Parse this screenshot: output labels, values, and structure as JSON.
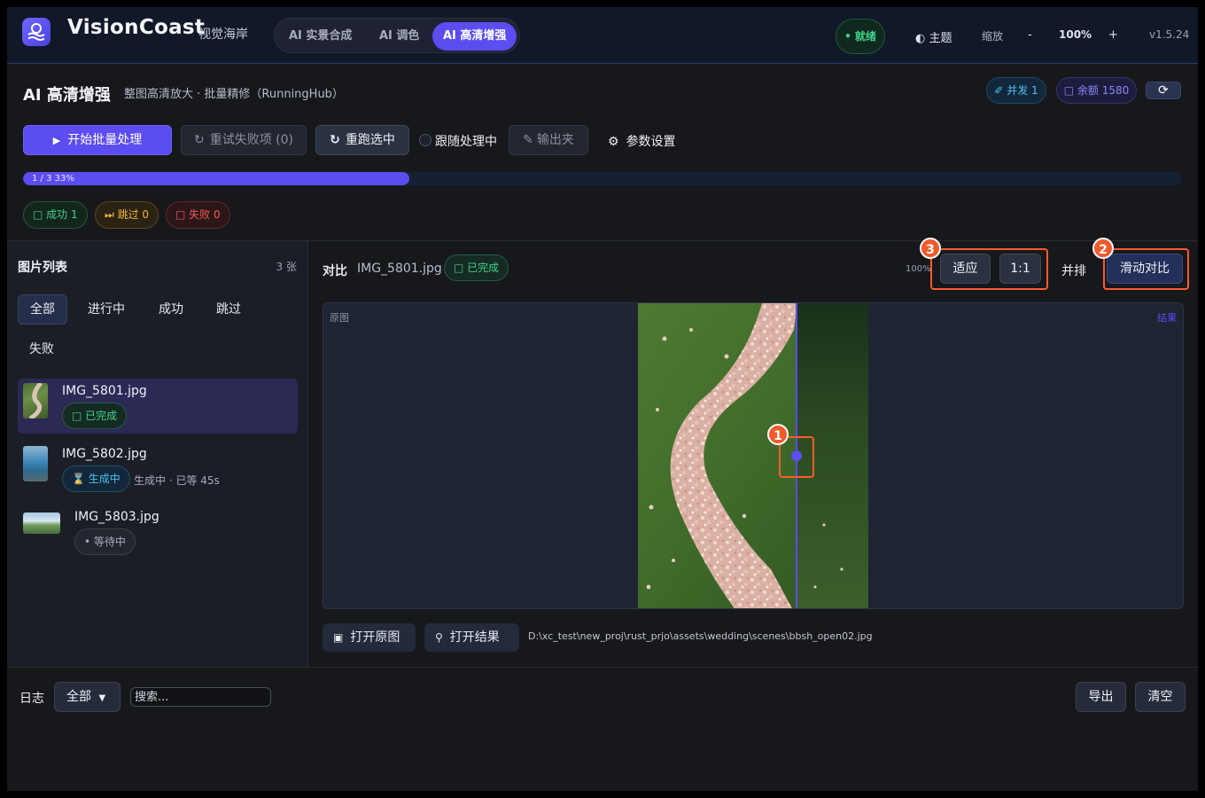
{
  "app": {
    "brand": "VisionCoast",
    "brand_sub": "视觉海岸",
    "mode_tabs": [
      "AI 实景合成",
      "AI 调色",
      "AI 高清增强"
    ],
    "active_mode": 2,
    "status": "• 就绪",
    "theme_label": "◐ 主题",
    "zoom_label": "缩放",
    "zoom_minus": "-",
    "zoom_value": "100%",
    "zoom_plus": "+",
    "version": "v1.5.24"
  },
  "header": {
    "title": "AI 高清增强",
    "subtitle": "整图高清放大 · 批量精修（RunningHub）",
    "concurrency": "✐ 并发 1",
    "balance": "□ 余额 1580",
    "refresh_icon": "⟳"
  },
  "toolbar": {
    "start": "开始批量处理",
    "retry_failed": "重试失败项 (0)",
    "rerun_selected": "重跑选中",
    "follow_processing": "跟随处理中",
    "output_folder": "输出夹",
    "params": "参数设置"
  },
  "progress": {
    "text": "1 / 3   33%",
    "fraction": 0.333
  },
  "stats": {
    "success": "□ 成功 1",
    "skipped": "⏭ 跳过 0",
    "failed": "□ 失败 0"
  },
  "sidebar": {
    "title": "图片列表",
    "count": "3 张",
    "filters": [
      "全部",
      "进行中",
      "成功",
      "跳过",
      "失败"
    ],
    "files": [
      {
        "name": "IMG_5801.jpg",
        "status": "□ 已完成",
        "note": ""
      },
      {
        "name": "IMG_5802.jpg",
        "status": "⌛ 生成中",
        "note": "生成中 · 已等 45s"
      },
      {
        "name": "IMG_5803.jpg",
        "status": "• 等待中",
        "note": ""
      }
    ]
  },
  "compare": {
    "label": "对比",
    "file": "IMG_5801.jpg",
    "status": "□ 已完成",
    "zoom": "100%",
    "fit": "适应",
    "one_to_one": "1:1",
    "side_by_side": "并排",
    "slide_compare": "滑动对比",
    "original_label": "原图",
    "result_label": "结果",
    "markers": [
      "1",
      "2",
      "3"
    ],
    "slider_position": 0.69
  },
  "actions": {
    "open_original": "打开原图",
    "open_result": "打开结果",
    "path": "D:\\xc_test\\new_proj\\rust_prjo\\assets\\wedding\\scenes\\bbsh_open02.jpg"
  },
  "log": {
    "label": "日志",
    "filter": "全部",
    "search_placeholder": "搜索...",
    "export": "导出",
    "clear": "清空"
  },
  "colors": {
    "accent": "#5b4df0",
    "success": "#3fd48a",
    "warning": "#f2b63d",
    "danger": "#f05a5a",
    "callout": "#ff5a2e"
  }
}
